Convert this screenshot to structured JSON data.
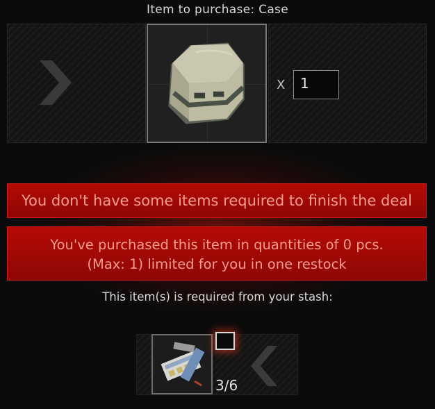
{
  "header": {
    "title": "Item to purchase: Case"
  },
  "purchase": {
    "item_icon": "case-icon",
    "multiplier_label": "X",
    "quantity_value": "1"
  },
  "errors": {
    "missing_items": "You don't have some items required to finish the deal",
    "limit_line1": "You've purchased this item in quantities of 0 pcs.",
    "limit_line2": "(Max: 1) limited for you in one restock"
  },
  "requirements": {
    "label": "This item(s) is required from your stash:",
    "items": [
      {
        "icon": "medical-supplies-icon",
        "count": "3/6"
      }
    ]
  },
  "colors": {
    "banner_bg": "#a10805",
    "banner_text": "#ff9d8f",
    "background": "#0b0b0b"
  }
}
